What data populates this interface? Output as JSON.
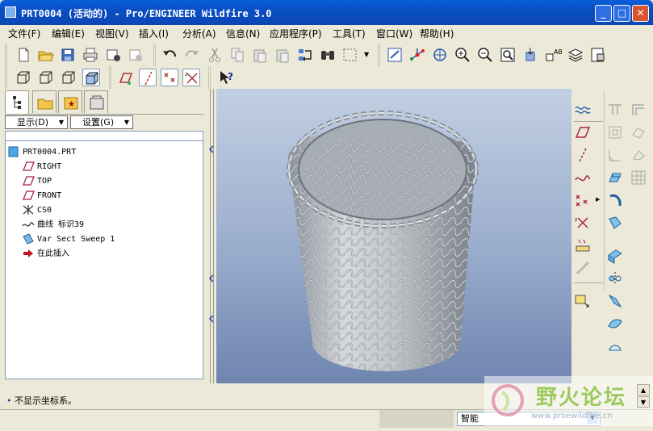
{
  "window": {
    "title": "PRT0004 (活动的) - Pro/ENGINEER Wildfire 3.0"
  },
  "menubar": [
    "文件(F)",
    "编辑(E)",
    "视图(V)",
    "插入(I)",
    "分析(A)",
    "信息(N)",
    "应用程序(P)",
    "工具(T)",
    "窗口(W)",
    "帮助(H)"
  ],
  "panel": {
    "show_label": "显示(D)",
    "settings_label": "设置(G)"
  },
  "tree": [
    {
      "label": "PRT0004.PRT",
      "icon": "part-icon"
    },
    {
      "label": "RIGHT",
      "icon": "datum-plane-icon"
    },
    {
      "label": "TOP",
      "icon": "datum-plane-icon"
    },
    {
      "label": "FRONT",
      "icon": "datum-plane-icon"
    },
    {
      "label": "CS0",
      "icon": "coordinate-system-icon"
    },
    {
      "label": "曲线 标识39",
      "icon": "curve-icon"
    },
    {
      "label": "Var Sect Sweep 1",
      "icon": "sweep-icon"
    },
    {
      "label": "在此插入",
      "icon": "insert-here-arrow-icon"
    }
  ],
  "status": {
    "message": "不显示坐标系。",
    "filter": "智能"
  },
  "watermark": {
    "text": "野火论坛",
    "url": "www.proewildfire.cn"
  },
  "colors": {
    "title_bar": "#0a4fc4",
    "viewport_top": "#c2cfe2",
    "viewport_bottom": "#6f85b0",
    "model": "#c0c4c8"
  }
}
